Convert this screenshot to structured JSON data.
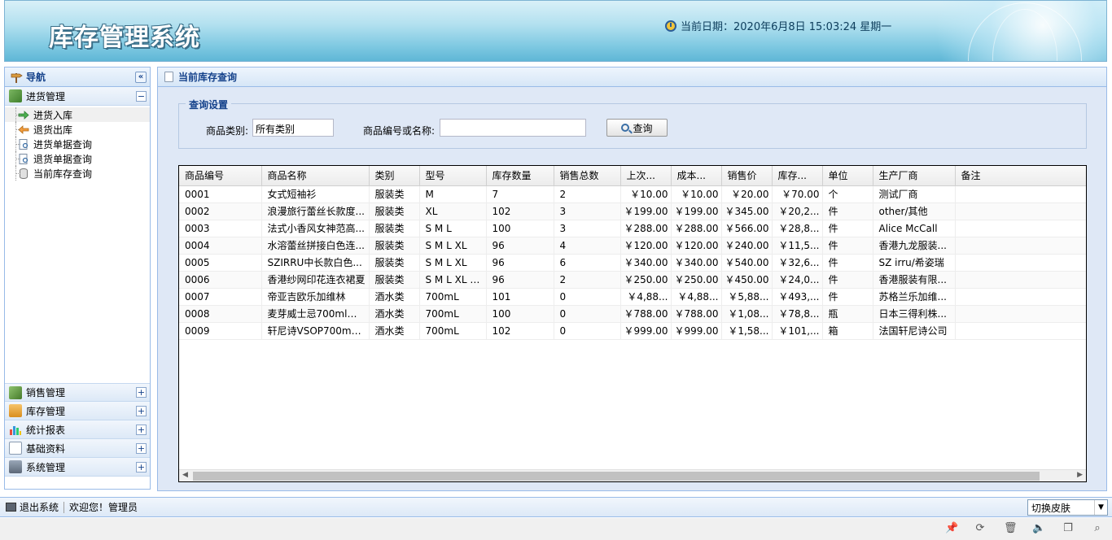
{
  "header": {
    "app_title": "库存管理系统",
    "date_text": "当前日期：2020年6月8日 15:03:24 星期一"
  },
  "nav": {
    "title": "导航",
    "collapse_icon": "double-chevron-left",
    "groups": [
      {
        "label": "进货管理",
        "toggle": "−"
      },
      {
        "label": "销售管理",
        "toggle": "+"
      },
      {
        "label": "库存管理",
        "toggle": "+"
      },
      {
        "label": "统计报表",
        "toggle": "+"
      },
      {
        "label": "基础资料",
        "toggle": "+"
      },
      {
        "label": "系统管理",
        "toggle": "+"
      }
    ],
    "tree": [
      {
        "label": "进货入库"
      },
      {
        "label": "退货出库"
      },
      {
        "label": "进货单据查询"
      },
      {
        "label": "退货单据查询"
      },
      {
        "label": "当前库存查询"
      }
    ]
  },
  "main": {
    "title": "当前库存查询",
    "query": {
      "legend": "查询设置",
      "category_label": "商品类别:",
      "category_value": "所有类别",
      "keyword_label": "商品编号或名称:",
      "keyword_value": "",
      "button_label": "查询"
    },
    "grid": {
      "columns": [
        "商品编号",
        "商品名称",
        "类别",
        "型号",
        "库存数量",
        "销售总数",
        "上次...",
        "成本...",
        "销售价",
        "库存...",
        "单位",
        "生产厂商",
        "备注"
      ],
      "rows": [
        [
          "0001",
          "女式短袖衫",
          "服装类",
          "M",
          "7",
          "2",
          "￥10.00",
          "￥10.00",
          "￥20.00",
          "￥70.00",
          "个",
          "测试厂商",
          ""
        ],
        [
          "0002",
          "浪漫旅行蕾丝长款度...",
          "服装类",
          "XL",
          "102",
          "3",
          "￥199.00",
          "￥199.00",
          "￥345.00",
          "￥20,2...",
          "件",
          "other/其他",
          ""
        ],
        [
          "0003",
          "法式小香风女神范高...",
          "服装类",
          "S M L",
          "100",
          "3",
          "￥288.00",
          "￥288.00",
          "￥566.00",
          "￥28,8...",
          "件",
          "Alice McCall",
          ""
        ],
        [
          "0004",
          "水溶蕾丝拼接白色连...",
          "服装类",
          "S M L XL",
          "96",
          "4",
          "￥120.00",
          "￥120.00",
          "￥240.00",
          "￥11,5...",
          "件",
          "香港九龙服装...",
          ""
        ],
        [
          "0005",
          "SZIRRU中长款白色...",
          "服装类",
          "S M L XL",
          "96",
          "6",
          "￥340.00",
          "￥340.00",
          "￥540.00",
          "￥32,6...",
          "件",
          "SZ irru/希姿瑞",
          ""
        ],
        [
          "0006",
          "香港纱网印花连衣裙夏",
          "服装类",
          "S M L XL 2...",
          "96",
          "2",
          "￥250.00",
          "￥250.00",
          "￥450.00",
          "￥24,0...",
          "件",
          "香港服装有限...",
          ""
        ],
        [
          "0007",
          "帝亚吉欧乐加维林",
          "酒水类",
          "700mL",
          "101",
          "0",
          "￥4,88...",
          "￥4,88...",
          "￥5,88...",
          "￥493,...",
          "件",
          "苏格兰乐加维...",
          ""
        ],
        [
          "0008",
          "麦芽威士忌700ml日...",
          "酒水类",
          "700mL",
          "100",
          "0",
          "￥788.00",
          "￥788.00",
          "￥1,08...",
          "￥78,8...",
          "瓶",
          "日本三得利株...",
          ""
        ],
        [
          "0009",
          "轩尼诗VSOP700mL...",
          "酒水类",
          "700mL",
          "102",
          "0",
          "￥999.00",
          "￥999.00",
          "￥1,58...",
          "￥101,...",
          "箱",
          "法国轩尼诗公司",
          ""
        ]
      ]
    }
  },
  "footer": {
    "logout_label": "退出系统",
    "welcome_text": "欢迎您！管理员",
    "skin_label": "切换皮肤"
  },
  "colors": {
    "panel_border": "#99bbe8",
    "panel_title": "#15428b",
    "main_bg": "#dfe8f6"
  }
}
